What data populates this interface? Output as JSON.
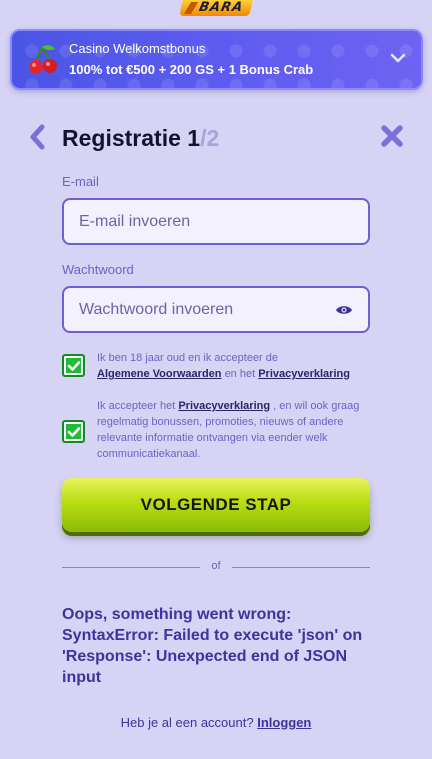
{
  "brand": {
    "logo_text": "BARA"
  },
  "bonus": {
    "title": "Casino Welkomstbonus",
    "offer": "100% tot €500 + 200 GS + 1 Bonus Crab"
  },
  "header": {
    "title": "Registratie",
    "step_current": "1",
    "step_total": "/2"
  },
  "form": {
    "email": {
      "label": "E-mail",
      "placeholder": "E-mail invoeren",
      "value": ""
    },
    "password": {
      "label": "Wachtwoord",
      "placeholder": "Wachtwoord invoeren",
      "value": ""
    },
    "consent_terms": {
      "checked": true,
      "text_1": "Ik ben 18 jaar oud en ik accepteer de",
      "link_1": "Algemene Voorwaarden",
      "text_2": "en het",
      "link_2": "Privacyverklaring"
    },
    "consent_marketing": {
      "checked": true,
      "text_1": "Ik accepteer het",
      "link_1": "Privacyverklaring",
      "text_2": ", en wil ook graag regelmatig bonussen, promoties, nieuws of andere relevante informatie ontvangen via eender welk communicatiekanaal."
    },
    "submit_label": "VOLGENDE STAP",
    "divider_text": "of"
  },
  "error_message": "Oops, something went wrong: SyntaxError: Failed to execute 'json' on 'Response': Unexpected end of JSON input",
  "footer": {
    "prompt": "Heb je al een account?",
    "login_link": "Inloggen"
  },
  "colors": {
    "background": "#d6d3f4",
    "accent": "#6d5fd6",
    "banner": "#4a55e6",
    "cta": "#b9dd11",
    "checkbox": "#1fbd35"
  }
}
